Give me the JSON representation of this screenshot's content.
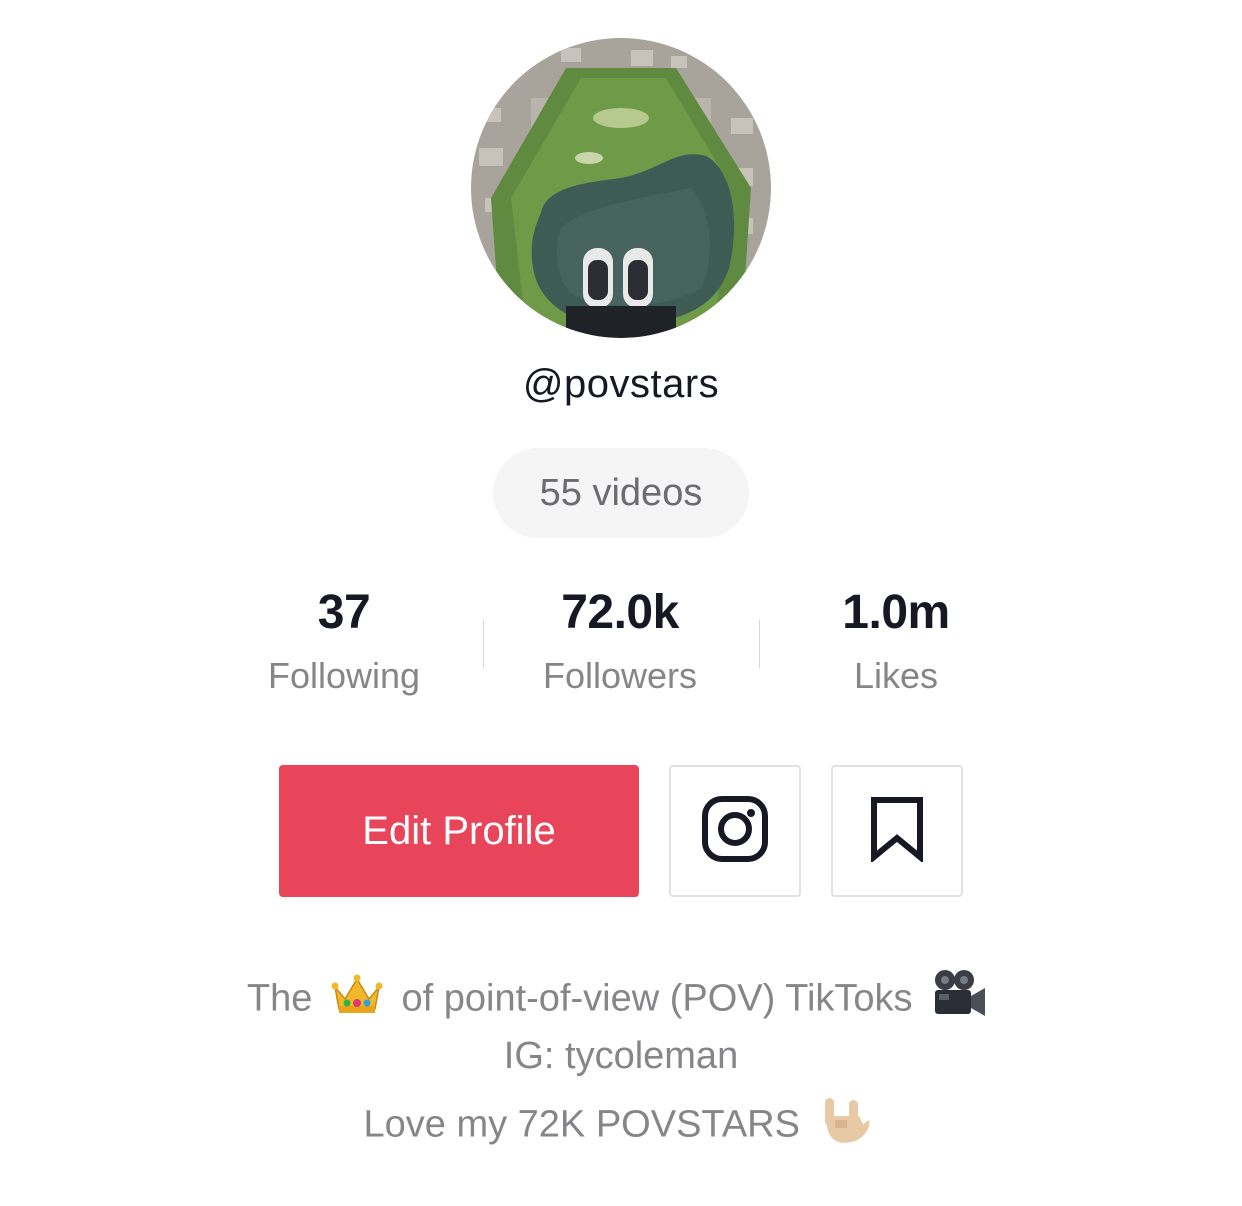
{
  "profile": {
    "username": "@povstars",
    "videos_label": "55 videos"
  },
  "stats": [
    {
      "value": "37",
      "label": "Following"
    },
    {
      "value": "72.0k",
      "label": "Followers"
    },
    {
      "value": "1.0m",
      "label": "Likes"
    }
  ],
  "actions": {
    "edit_profile_label": "Edit Profile",
    "instagram_icon": "instagram-icon",
    "bookmark_icon": "bookmark-icon"
  },
  "bio": {
    "line1_before": "The",
    "line1_after": "of point-of-view (POV) TikToks",
    "line2": "IG: tycoleman",
    "line3": "Love my 72K POVSTARS",
    "emoji_1": "crown-emoji",
    "emoji_2": "movie-camera-emoji",
    "emoji_3": "love-you-gesture-emoji"
  },
  "colors": {
    "accent": "#e8445a",
    "primary_text": "#161823",
    "secondary_text": "#85858a",
    "pill_background": "#f5f5f6"
  }
}
